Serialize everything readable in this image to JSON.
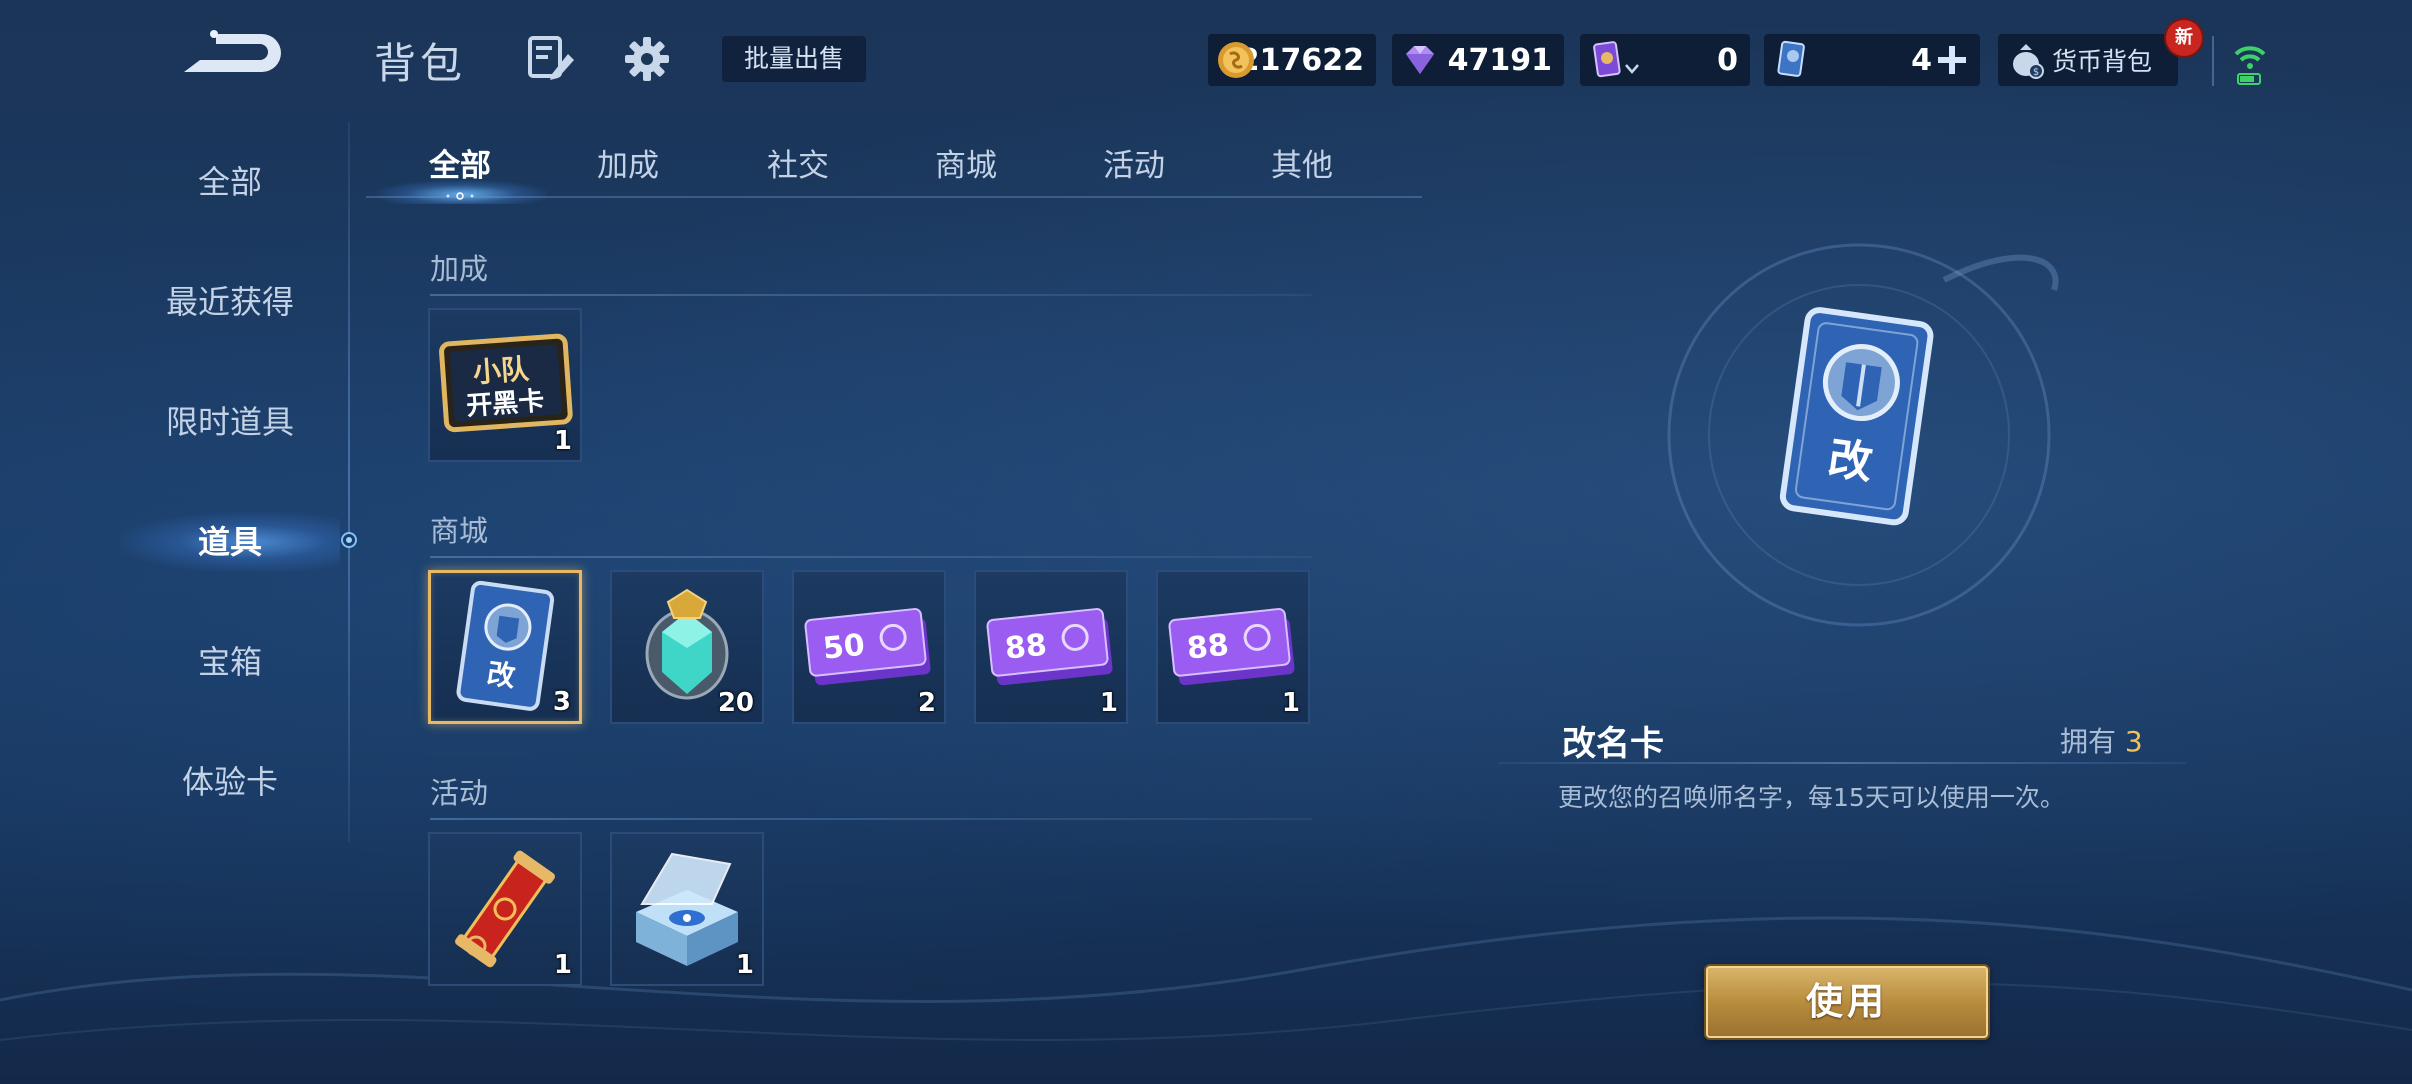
{
  "header": {
    "title": "背包",
    "batch_sell_label": "批量出售",
    "coins": "217622",
    "gems": "47191",
    "card1_count": "0",
    "card2_count": "4",
    "wallet_label": "货币背包",
    "new_badge": "新"
  },
  "sidebar": {
    "items": [
      {
        "label": "全部"
      },
      {
        "label": "最近获得"
      },
      {
        "label": "限时道具"
      },
      {
        "label": "道具"
      },
      {
        "label": "宝箱"
      },
      {
        "label": "体验卡"
      }
    ],
    "active": "道具"
  },
  "tabs": {
    "items": [
      {
        "label": "全部"
      },
      {
        "label": "加成"
      },
      {
        "label": "社交"
      },
      {
        "label": "商城"
      },
      {
        "label": "活动"
      },
      {
        "label": "其他"
      }
    ],
    "active": "全部"
  },
  "sections": [
    {
      "title": "加成",
      "items": [
        {
          "icon": "squad-card-icon",
          "art_text_1": "小队",
          "art_text_2": "开黑卡",
          "count": "1"
        }
      ]
    },
    {
      "title": "商城",
      "items": [
        {
          "icon": "rename-card-icon",
          "art_text": "改",
          "count": "3",
          "selected": true
        },
        {
          "icon": "crystal-gem-icon",
          "count": "20"
        },
        {
          "icon": "voucher-50-icon",
          "art_text": "50",
          "count": "2"
        },
        {
          "icon": "voucher-88-icon",
          "art_text": "88",
          "count": "1"
        },
        {
          "icon": "voucher-88-icon",
          "art_text": "88",
          "count": "1"
        }
      ]
    },
    {
      "title": "活动",
      "items": [
        {
          "icon": "red-scroll-icon",
          "count": "1"
        },
        {
          "icon": "crystal-box-icon",
          "count": "1"
        }
      ]
    }
  ],
  "detail": {
    "name": "改名卡",
    "own_label": "拥有",
    "own_count": "3",
    "description": "更改您的召唤师名字，每15天可以使用一次。",
    "card_art_text": "改",
    "use_label": "使用"
  },
  "colors": {
    "accent_gold": "#e7b865",
    "own_count": "#f0c05a",
    "new_badge": "#c8261e",
    "active_glow": "#6eb8ff"
  }
}
